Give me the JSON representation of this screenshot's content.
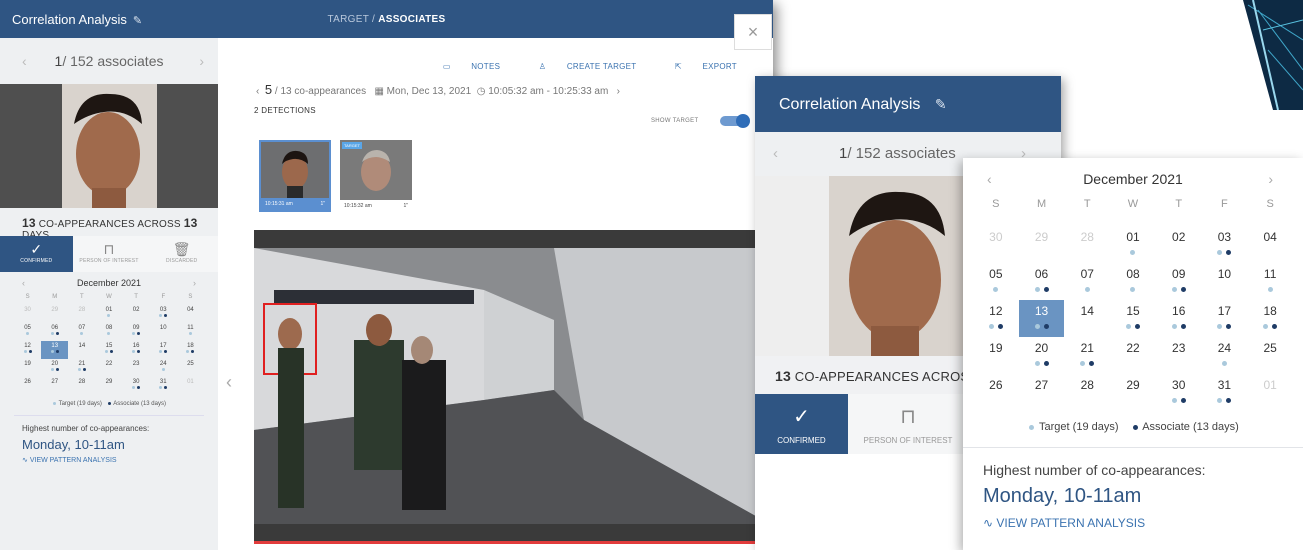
{
  "colors": {
    "brand": "#2f5583",
    "accent": "#3b73b0",
    "selected_day": "#6a94c2",
    "target_dot": "#aac9dc",
    "associate_dot": "#1f3c66"
  },
  "window": {
    "title": "Correlation Analysis",
    "breadcrumb_target": "TARGET",
    "breadcrumb_sep": "/",
    "breadcrumb_current": "ASSOCIATES",
    "close_label": "×"
  },
  "left": {
    "nav_index": "1",
    "nav_total": "/ 152 associates",
    "coapp_count": "13",
    "coapp_text": "CO-APPEARANCES ACROSS",
    "coapp_days": "13",
    "coapp_suffix": "DAYS",
    "tabs": [
      "CONFIRMED",
      "PERSON OF INTEREST",
      "DISCARDED"
    ],
    "calendar_month": "December 2021",
    "weekdays": [
      "S",
      "M",
      "T",
      "W",
      "T",
      "F",
      "S"
    ],
    "legend_target": "Target (19 days)",
    "legend_associate": "Associate (13 days)",
    "highest_label": "Highest number of co-appearances:",
    "highest_value": "Monday, 10-11am",
    "pattern_link": "VIEW PATTERN ANALYSIS"
  },
  "calendar_days": [
    {
      "n": "30",
      "muted": true,
      "t": false,
      "a": false
    },
    {
      "n": "29",
      "muted": true,
      "t": false,
      "a": false
    },
    {
      "n": "28",
      "muted": true,
      "t": false,
      "a": false
    },
    {
      "n": "01",
      "t": true,
      "a": false
    },
    {
      "n": "02",
      "t": false,
      "a": false
    },
    {
      "n": "03",
      "t": true,
      "a": true
    },
    {
      "n": "04",
      "t": false,
      "a": false
    },
    {
      "n": "05",
      "t": true,
      "a": false
    },
    {
      "n": "06",
      "t": true,
      "a": true
    },
    {
      "n": "07",
      "t": true,
      "a": false
    },
    {
      "n": "08",
      "t": true,
      "a": false
    },
    {
      "n": "09",
      "t": true,
      "a": true
    },
    {
      "n": "10",
      "t": false,
      "a": false
    },
    {
      "n": "11",
      "t": true,
      "a": false
    },
    {
      "n": "12",
      "t": true,
      "a": true
    },
    {
      "n": "13",
      "sel": true,
      "t": true,
      "a": true
    },
    {
      "n": "14",
      "t": false,
      "a": false
    },
    {
      "n": "15",
      "t": true,
      "a": true
    },
    {
      "n": "16",
      "t": true,
      "a": true
    },
    {
      "n": "17",
      "t": true,
      "a": true
    },
    {
      "n": "18",
      "t": true,
      "a": true
    },
    {
      "n": "19",
      "t": false,
      "a": false
    },
    {
      "n": "20",
      "t": true,
      "a": true
    },
    {
      "n": "21",
      "t": true,
      "a": true
    },
    {
      "n": "22",
      "t": false,
      "a": false
    },
    {
      "n": "23",
      "t": false,
      "a": false
    },
    {
      "n": "24",
      "t": true,
      "a": false
    },
    {
      "n": "25",
      "t": false,
      "a": false
    },
    {
      "n": "26",
      "t": false,
      "a": false
    },
    {
      "n": "27",
      "t": false,
      "a": false
    },
    {
      "n": "28",
      "t": false,
      "a": false
    },
    {
      "n": "29",
      "t": false,
      "a": false
    },
    {
      "n": "30",
      "t": true,
      "a": true
    },
    {
      "n": "31",
      "t": true,
      "a": true
    },
    {
      "n": "01",
      "muted": true,
      "t": false,
      "a": false
    }
  ],
  "main": {
    "toolbar": [
      "NOTES",
      "CREATE TARGET",
      "EXPORT"
    ],
    "nav_index": "5",
    "nav_total": "/ 13 co-appearances",
    "date": "Mon, Dec 13, 2021",
    "time_range": "10:05:32 am - 10:25:33 am",
    "detections_label": "2 DETECTIONS",
    "show_target_label": "SHOW TARGET",
    "thumb1_time": "10:15:31 am",
    "thumb1_count": "1\"",
    "thumb2_tag": "TARGET",
    "thumb2_time": "10:15:32 am",
    "thumb2_count": "1\""
  },
  "overlay": {
    "title": "Correlation Analysis",
    "nav_index": "1",
    "nav_total": "/ 152 associates",
    "coapp_count": "13",
    "coapp_text": "CO-APPEARANCES ACROSS",
    "tabs": [
      "CONFIRMED",
      "PERSON OF INTEREST"
    ],
    "calendar_month": "December 2021",
    "legend_target": "Target (19 days)",
    "legend_associate": "Associate (13 days)",
    "highest_label": "Highest number of co-appearances:",
    "highest_value": "Monday, 10-11am",
    "pattern_link": "VIEW PATTERN ANALYSIS"
  }
}
